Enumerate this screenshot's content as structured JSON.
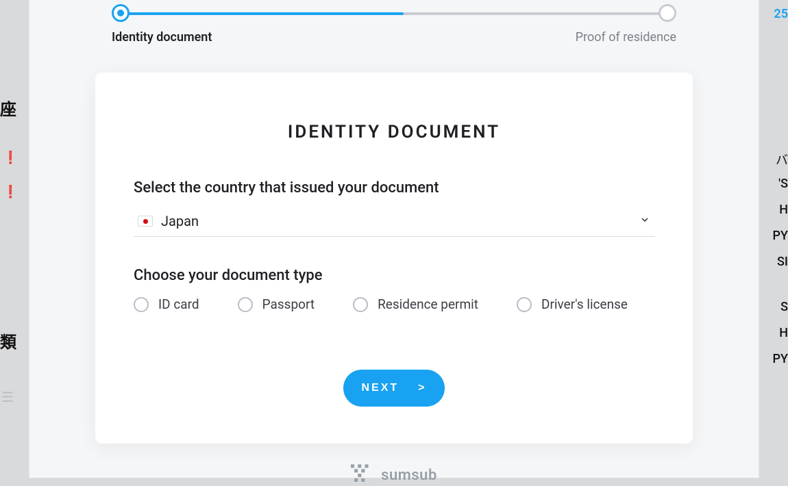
{
  "background": {
    "top_link_text": "25",
    "left_labels": {
      "l1": "座",
      "l2": "類"
    },
    "right_labels": {
      "r0": "バ",
      "r1": "'S",
      "r2": "H",
      "r3": "PY",
      "r4": "SI",
      "r5": "S",
      "r6": "H",
      "r7": "PY"
    }
  },
  "stepper": {
    "steps": [
      {
        "label": "Identity document",
        "active": true
      },
      {
        "label": "Proof of residence",
        "active": false
      }
    ]
  },
  "card": {
    "title": "IDENTITY DOCUMENT",
    "country_section_label": "Select the country that issued your document",
    "selected_country": "Japan",
    "doc_type_section_label": "Choose your document type",
    "doc_types": [
      {
        "label": "ID card"
      },
      {
        "label": "Passport"
      },
      {
        "label": "Residence permit"
      },
      {
        "label": "Driver's license"
      }
    ],
    "next_button_label": "NEXT",
    "next_button_arrow": ">"
  },
  "footer": {
    "brand": "sumsub"
  }
}
